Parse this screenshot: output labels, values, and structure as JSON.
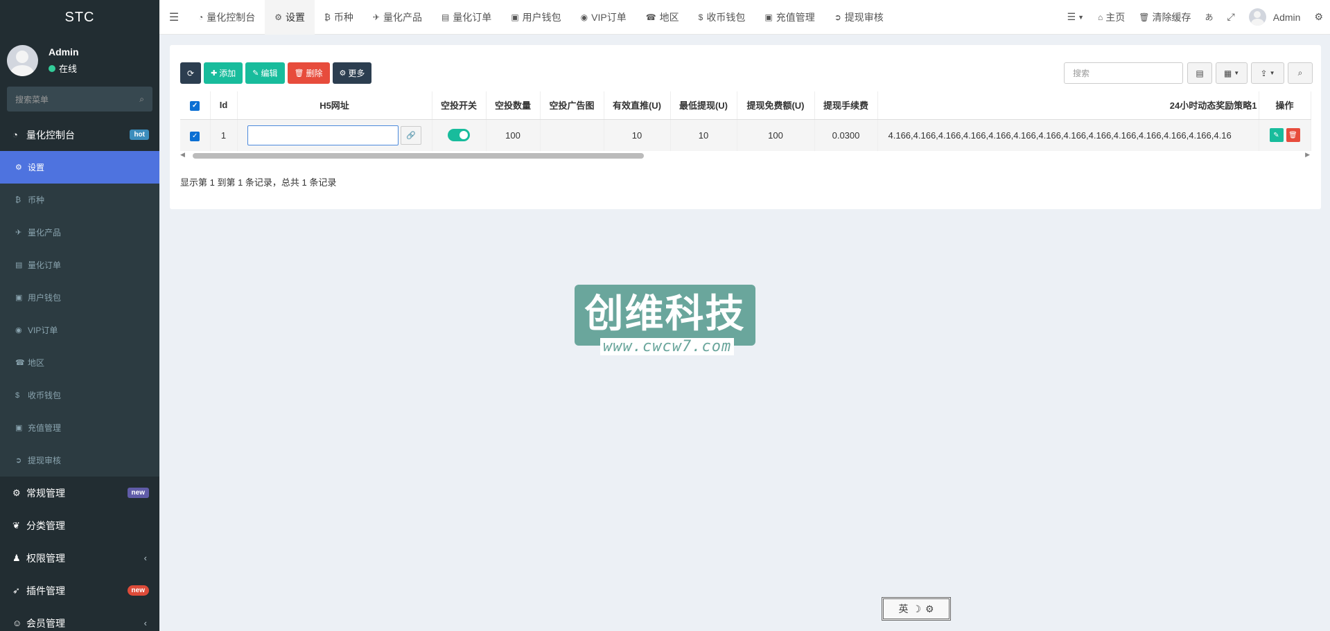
{
  "sidebar": {
    "logo": "STC",
    "user": {
      "name": "Admin",
      "status": "在线"
    },
    "search_placeholder": "搜索菜单",
    "main_item": {
      "label": "量化控制台",
      "badge": "hot",
      "icon": "dashboard-icon"
    },
    "sub_items": [
      {
        "label": "设置",
        "icon": "gear-icon",
        "glyph": "⚙"
      },
      {
        "label": "币种",
        "icon": "bitcoin-icon",
        "glyph": "₿"
      },
      {
        "label": "量化产品",
        "icon": "plane-icon",
        "glyph": "✈"
      },
      {
        "label": "量化订单",
        "icon": "book-icon",
        "glyph": "▤"
      },
      {
        "label": "用户钱包",
        "icon": "money-icon",
        "glyph": "▣"
      },
      {
        "label": "VIP订单",
        "icon": "chevron-circle-icon",
        "glyph": "◉"
      },
      {
        "label": "地区",
        "icon": "phone-square-icon",
        "glyph": "☎"
      },
      {
        "label": "收币钱包",
        "icon": "dollar-icon",
        "glyph": "$"
      },
      {
        "label": "充值管理",
        "icon": "money-icon",
        "glyph": "▣"
      },
      {
        "label": "提现审核",
        "icon": "arrow-circle-icon",
        "glyph": "➲"
      }
    ],
    "groups": [
      {
        "label": "常规管理",
        "badge": "new",
        "icon": "cogs-icon",
        "glyph": "⚙"
      },
      {
        "label": "分类管理",
        "icon": "leaf-icon",
        "glyph": "❦"
      },
      {
        "label": "权限管理",
        "icon": "group-icon",
        "glyph": "♟",
        "chevron": "‹"
      },
      {
        "label": "插件管理",
        "badge": "new",
        "icon": "rocket-icon",
        "glyph": "➶"
      },
      {
        "label": "会员管理",
        "icon": "user-circle-icon",
        "glyph": "☺",
        "chevron": "‹"
      }
    ]
  },
  "topbar": {
    "tabs": [
      {
        "label": "量化控制台",
        "icon": "dashboard-icon",
        "glyph": "◔"
      },
      {
        "label": "设置",
        "icon": "gear-icon",
        "glyph": "⚙"
      },
      {
        "label": "币种",
        "icon": "bitcoin-icon",
        "glyph": "₿"
      },
      {
        "label": "量化产品",
        "icon": "plane-icon",
        "glyph": "✈"
      },
      {
        "label": "量化订单",
        "icon": "book-icon",
        "glyph": "▤"
      },
      {
        "label": "用户钱包",
        "icon": "money-icon",
        "glyph": "▣"
      },
      {
        "label": "VIP订单",
        "icon": "chevron-circle-icon",
        "glyph": "◉"
      },
      {
        "label": "地区",
        "icon": "phone-square-icon",
        "glyph": "☎"
      },
      {
        "label": "收币钱包",
        "icon": "dollar-icon",
        "glyph": "$"
      },
      {
        "label": "充值管理",
        "icon": "money-icon",
        "glyph": "▣"
      },
      {
        "label": "提现审核",
        "icon": "arrow-circle-icon",
        "glyph": "➲"
      }
    ],
    "right": {
      "home": "主页",
      "clear_cache": "清除缓存",
      "admin": "Admin"
    }
  },
  "toolbar": {
    "add": "添加",
    "edit": "编辑",
    "delete": "删除",
    "more": "更多",
    "search_placeholder": "搜索"
  },
  "table": {
    "headers": {
      "id": "Id",
      "h5": "H5网址",
      "airdrop_switch": "空投开关",
      "airdrop_count": "空投数量",
      "airdrop_image": "空投广告图",
      "valid_direct": "有效直推(U)",
      "min_withdraw": "最低提现(U)",
      "withdraw_free": "提现免费额(U)",
      "withdraw_fee": "提现手续费",
      "strategy": "24小时动态奖励策略1",
      "actions": "操作"
    },
    "row": {
      "id": "1",
      "h5_value": "",
      "airdrop_switch_on": true,
      "airdrop_count": "100",
      "airdrop_image": "",
      "valid_direct": "10",
      "min_withdraw": "10",
      "withdraw_free": "100",
      "withdraw_fee": "0.0300",
      "strategy": "4.166,4.166,4.166,4.166,4.166,4.166,4.166,4.166,4.166,4.166,4.166,4.166,4.166,4.16"
    }
  },
  "pager": "显示第 1 到第 1 条记录，总共 1 条记录",
  "watermark": {
    "title": "创维科技",
    "url": "www.cwcw7.com"
  },
  "ime": {
    "label": "英"
  }
}
